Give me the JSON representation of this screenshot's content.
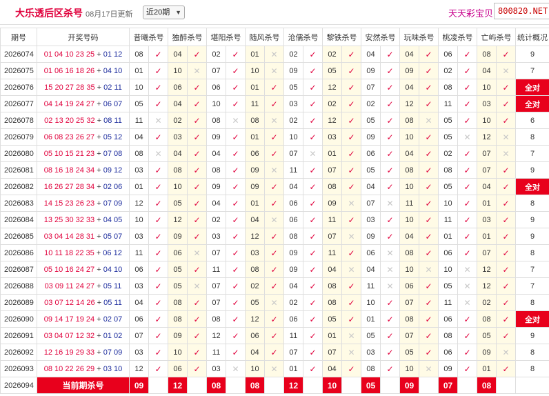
{
  "header": {
    "title": "大乐透后区杀号",
    "updated": "08月17日更新",
    "period_select": "近20期",
    "brand": "天天彩宝贝,",
    "site": "800820.NET"
  },
  "columns": [
    "期号",
    "开奖号码",
    "昔曦杀号",
    "独醉杀号",
    "堪阳杀号",
    "随风杀号",
    "沧儒杀号",
    "黎铁杀号",
    "安然杀号",
    "玩味杀号",
    "桃凌杀号",
    "亡屿杀号",
    "统计概况"
  ],
  "full_label": "全对",
  "current_label": "当前期杀号",
  "rows": [
    {
      "issue": "2026074",
      "front": "01 04 10 23 25",
      "back": "01 12",
      "preds": [
        "08",
        "04",
        "02",
        "01",
        "02",
        "02",
        "04",
        "04",
        "06",
        "08"
      ],
      "ok": [
        1,
        1,
        1,
        0,
        1,
        1,
        1,
        1,
        1,
        1
      ],
      "stat": "9"
    },
    {
      "issue": "2026075",
      "front": "01 06 16 18 26",
      "back": "04 10",
      "preds": [
        "01",
        "10",
        "07",
        "10",
        "09",
        "05",
        "09",
        "09",
        "02",
        "04"
      ],
      "ok": [
        1,
        0,
        1,
        0,
        1,
        1,
        1,
        1,
        1,
        0
      ],
      "stat": "7"
    },
    {
      "issue": "2026076",
      "front": "15 20 27 28 35",
      "back": "02 11",
      "preds": [
        "10",
        "06",
        "06",
        "01",
        "05",
        "12",
        "07",
        "04",
        "08",
        "10"
      ],
      "ok": [
        1,
        1,
        1,
        1,
        1,
        1,
        1,
        1,
        1,
        1
      ],
      "stat": "全对"
    },
    {
      "issue": "2026077",
      "front": "04 14 19 24 27",
      "back": "06 07",
      "preds": [
        "05",
        "04",
        "10",
        "11",
        "03",
        "02",
        "02",
        "12",
        "11",
        "03"
      ],
      "ok": [
        1,
        1,
        1,
        1,
        1,
        1,
        1,
        1,
        1,
        1
      ],
      "stat": "全对"
    },
    {
      "issue": "2026078",
      "front": "02 13 20 25 32",
      "back": "08 11",
      "preds": [
        "11",
        "02",
        "08",
        "08",
        "02",
        "12",
        "05",
        "08",
        "05",
        "10"
      ],
      "ok": [
        0,
        1,
        0,
        0,
        1,
        1,
        1,
        0,
        1,
        1
      ],
      "stat": "6"
    },
    {
      "issue": "2026079",
      "front": "06 08 23 26 27",
      "back": "05 12",
      "preds": [
        "04",
        "03",
        "09",
        "01",
        "10",
        "03",
        "09",
        "10",
        "05",
        "12"
      ],
      "ok": [
        1,
        1,
        1,
        1,
        1,
        1,
        1,
        1,
        0,
        0
      ],
      "stat": "8"
    },
    {
      "issue": "2026080",
      "front": "05 10 15 21 23",
      "back": "07 08",
      "preds": [
        "08",
        "04",
        "04",
        "06",
        "07",
        "01",
        "06",
        "04",
        "02",
        "07"
      ],
      "ok": [
        0,
        1,
        1,
        1,
        0,
        1,
        1,
        1,
        1,
        0
      ],
      "stat": "7"
    },
    {
      "issue": "2026081",
      "front": "08 16 18 24 34",
      "back": "09 12",
      "preds": [
        "03",
        "08",
        "08",
        "09",
        "11",
        "07",
        "05",
        "08",
        "08",
        "07"
      ],
      "ok": [
        1,
        1,
        1,
        0,
        1,
        1,
        1,
        1,
        1,
        1
      ],
      "stat": "9"
    },
    {
      "issue": "2026082",
      "front": "16 26 27 28 34",
      "back": "02 06",
      "preds": [
        "01",
        "10",
        "09",
        "09",
        "04",
        "08",
        "04",
        "10",
        "05",
        "04"
      ],
      "ok": [
        1,
        1,
        1,
        1,
        1,
        1,
        1,
        1,
        1,
        1
      ],
      "stat": "全对"
    },
    {
      "issue": "2026083",
      "front": "14 15 23 26 23",
      "back": "07 09",
      "preds": [
        "12",
        "05",
        "04",
        "01",
        "06",
        "09",
        "07",
        "11",
        "10",
        "01"
      ],
      "ok": [
        1,
        1,
        1,
        1,
        1,
        0,
        0,
        1,
        1,
        1
      ],
      "stat": "8"
    },
    {
      "issue": "2026084",
      "front": "13 25 30 32 33",
      "back": "04 05",
      "preds": [
        "10",
        "12",
        "02",
        "04",
        "06",
        "11",
        "03",
        "10",
        "11",
        "03"
      ],
      "ok": [
        1,
        1,
        1,
        0,
        1,
        1,
        1,
        1,
        1,
        1
      ],
      "stat": "9"
    },
    {
      "issue": "2026085",
      "front": "03 04 14 28 31",
      "back": "05 07",
      "preds": [
        "03",
        "09",
        "03",
        "12",
        "08",
        "07",
        "09",
        "04",
        "01",
        "01"
      ],
      "ok": [
        1,
        1,
        1,
        1,
        1,
        0,
        1,
        1,
        1,
        1
      ],
      "stat": "9"
    },
    {
      "issue": "2026086",
      "front": "10 11 18 22 35",
      "back": "06 12",
      "preds": [
        "11",
        "06",
        "07",
        "03",
        "09",
        "11",
        "06",
        "08",
        "06",
        "07"
      ],
      "ok": [
        1,
        0,
        1,
        1,
        1,
        1,
        0,
        1,
        1,
        1
      ],
      "stat": "8"
    },
    {
      "issue": "2026087",
      "front": "05 10 16 24 27",
      "back": "04 10",
      "preds": [
        "06",
        "05",
        "11",
        "08",
        "09",
        "04",
        "04",
        "10",
        "10",
        "12"
      ],
      "ok": [
        1,
        1,
        1,
        1,
        1,
        0,
        0,
        0,
        0,
        1
      ],
      "stat": "7"
    },
    {
      "issue": "2026088",
      "front": "03 09 11 24 27",
      "back": "05 11",
      "preds": [
        "03",
        "05",
        "07",
        "02",
        "04",
        "08",
        "11",
        "06",
        "05",
        "12"
      ],
      "ok": [
        1,
        0,
        1,
        1,
        1,
        1,
        0,
        1,
        0,
        1
      ],
      "stat": "7"
    },
    {
      "issue": "2026089",
      "front": "03 07 12 14 26",
      "back": "05 11",
      "preds": [
        "04",
        "08",
        "07",
        "05",
        "02",
        "08",
        "10",
        "07",
        "11",
        "02"
      ],
      "ok": [
        1,
        1,
        1,
        0,
        1,
        1,
        1,
        1,
        0,
        1
      ],
      "stat": "8"
    },
    {
      "issue": "2026090",
      "front": "09 14 17 19 24",
      "back": "02 07",
      "preds": [
        "06",
        "08",
        "08",
        "12",
        "06",
        "05",
        "01",
        "08",
        "06",
        "08"
      ],
      "ok": [
        1,
        1,
        1,
        1,
        1,
        1,
        1,
        1,
        1,
        1
      ],
      "stat": "全对"
    },
    {
      "issue": "2026091",
      "front": "03 04 07 12 32",
      "back": "01 02",
      "preds": [
        "07",
        "09",
        "12",
        "06",
        "11",
        "01",
        "05",
        "07",
        "08",
        "05"
      ],
      "ok": [
        1,
        1,
        1,
        1,
        1,
        0,
        1,
        1,
        1,
        1
      ],
      "stat": "9"
    },
    {
      "issue": "2026092",
      "front": "12 16 19 29 33",
      "back": "07 09",
      "preds": [
        "03",
        "10",
        "11",
        "04",
        "07",
        "07",
        "03",
        "05",
        "06",
        "09"
      ],
      "ok": [
        1,
        1,
        1,
        1,
        1,
        0,
        1,
        1,
        1,
        0
      ],
      "stat": "8"
    },
    {
      "issue": "2026093",
      "front": "08 10 22 26 29",
      "back": "03 10",
      "preds": [
        "12",
        "06",
        "03",
        "10",
        "01",
        "04",
        "08",
        "10",
        "09",
        "01"
      ],
      "ok": [
        1,
        1,
        0,
        0,
        1,
        1,
        1,
        0,
        1,
        1
      ],
      "stat": "8"
    }
  ],
  "current": {
    "issue": "2026094",
    "preds": [
      "09",
      "12",
      "08",
      "08",
      "12",
      "10",
      "05",
      "09",
      "07",
      "08"
    ]
  }
}
